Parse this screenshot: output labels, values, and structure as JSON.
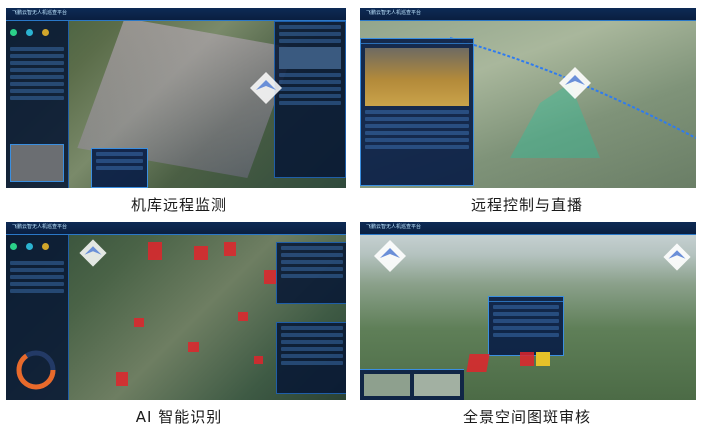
{
  "captions": {
    "tl": "机库远程监测",
    "tr": "远程控制与直播",
    "bl": "AI 智能识别",
    "br": "全景空间图斑审核"
  },
  "app_title": "飞鹏云智无人机巡查平台",
  "colors": {
    "accent": "#1d74d2",
    "panel_border": "#2a78c8",
    "alert": "#e0242b"
  }
}
